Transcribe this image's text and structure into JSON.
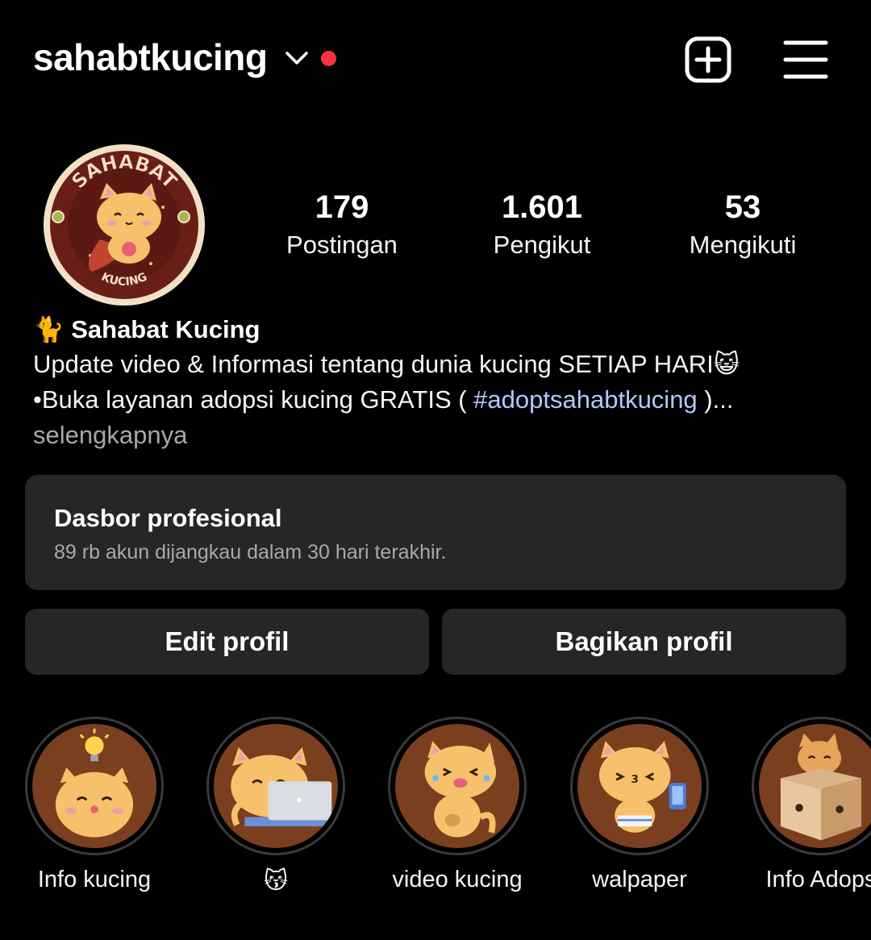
{
  "header": {
    "username": "sahabtkucing",
    "icons": {
      "dropdown": "chevron-down-icon",
      "notification": "notification-dot",
      "create": "plus-square-icon",
      "menu": "hamburger-menu-icon"
    },
    "notification_color": "#ff3040"
  },
  "profile": {
    "avatar_text_top": "SAHABAT",
    "avatar_text_bottom": "KUCING",
    "stats": [
      {
        "value": "179",
        "label": "Postingan"
      },
      {
        "value": "1.601",
        "label": "Pengikut"
      },
      {
        "value": "53",
        "label": "Mengikuti"
      }
    ]
  },
  "bio": {
    "name": "🐈 Sahabat Kucing",
    "line1": "Update video & Informasi tentang dunia kucing SETIAP HARI😺",
    "line2_prefix": "•Buka layanan adopsi kucing GRATIS ( ",
    "hashtag": "#adoptsahabtkucing",
    "line2_suffix": " )...",
    "more": "selengkapnya"
  },
  "dashboard": {
    "title": "Dasbor profesional",
    "subtitle": "89 rb akun dijangkau dalam 30 hari terakhir."
  },
  "actions": {
    "edit": "Edit profil",
    "share": "Bagikan profil"
  },
  "highlights": [
    {
      "label": "Info kucing"
    },
    {
      "label": "😽"
    },
    {
      "label": "video kucing"
    },
    {
      "label": "walpaper"
    },
    {
      "label": "Info Adops"
    }
  ],
  "colors": {
    "background": "#000000",
    "card": "#262626",
    "hashtag": "#b3c8ff",
    "highlight_bg": "#7a3f1f"
  }
}
